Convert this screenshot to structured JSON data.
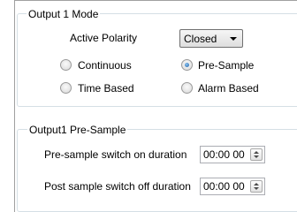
{
  "output_mode": {
    "title": "Output 1 Mode",
    "polarity_label": "Active Polarity",
    "polarity_value": "Closed",
    "radios": [
      {
        "label": "Continuous",
        "checked": false
      },
      {
        "label": "Pre-Sample",
        "checked": true
      },
      {
        "label": "Time Based",
        "checked": false
      },
      {
        "label": "Alarm Based",
        "checked": false
      }
    ]
  },
  "pre_sample": {
    "title": "Output1 Pre-Sample",
    "on_duration_label": "Pre-sample switch on duration",
    "on_duration_value": "00:00 00",
    "off_duration_label": "Post sample switch off duration",
    "off_duration_value": "00:00 00"
  },
  "colors": {
    "radio_selected": "#1a5ea8",
    "group_border": "#d5dfe5"
  }
}
